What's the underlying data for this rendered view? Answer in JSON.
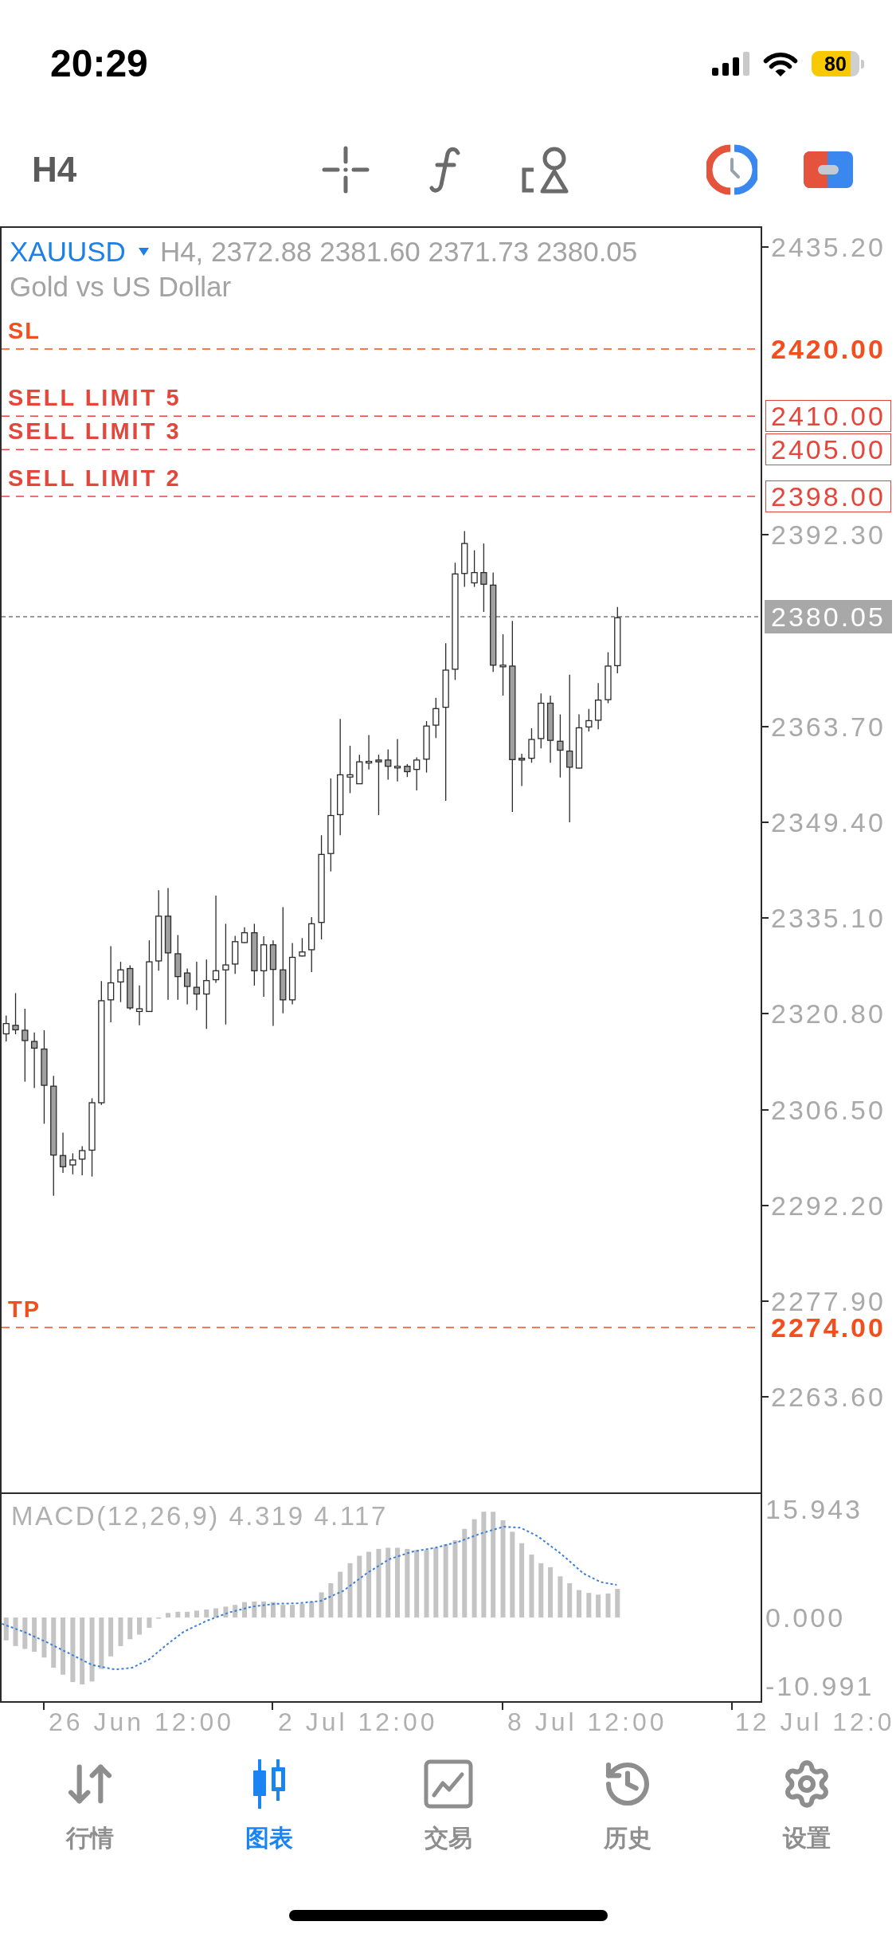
{
  "status_bar": {
    "time": "20:29",
    "battery": "80"
  },
  "toolbar": {
    "timeframe": "H4"
  },
  "chart": {
    "symbol": "XAUUSD",
    "ohlc": "H4, 2372.88 2381.60 2371.73 2380.05",
    "description": "Gold vs US Dollar",
    "orders": [
      {
        "kind": "stop",
        "label": "SL",
        "price": "2420.00",
        "color": "#f24e1e"
      },
      {
        "kind": "pending",
        "label": "SELL LIMIT 5",
        "price": "2410.00",
        "color": "#e4463b"
      },
      {
        "kind": "pending",
        "label": "SELL LIMIT 3",
        "price": "2405.00",
        "color": "#e4463b"
      },
      {
        "kind": "pending",
        "label": "SELL LIMIT 2",
        "price": "2398.00",
        "color": "#e4463b"
      },
      {
        "kind": "stop",
        "label": "TP",
        "price": "2274.00",
        "color": "#f24e1e"
      }
    ],
    "price_axis": [
      "2435.20",
      "2392.30",
      "2363.70",
      "2349.40",
      "2335.10",
      "2320.80",
      "2306.50",
      "2292.20",
      "2277.90",
      "2263.60"
    ],
    "current_price": "2380.05"
  },
  "indicator": {
    "label": "MACD(12,26,9) 4.319 4.117",
    "axis": [
      "15.943",
      "0.000",
      "-10.991"
    ]
  },
  "time_axis": [
    "26 Jun 12:00",
    "2 Jul 12:00",
    "8 Jul 12:00",
    "12 Jul 12:0"
  ],
  "tabs": [
    {
      "label": "行情",
      "selected": false
    },
    {
      "label": "图表",
      "selected": true
    },
    {
      "label": "交易",
      "selected": false
    },
    {
      "label": "历史",
      "selected": false
    },
    {
      "label": "设置",
      "selected": false
    }
  ]
}
